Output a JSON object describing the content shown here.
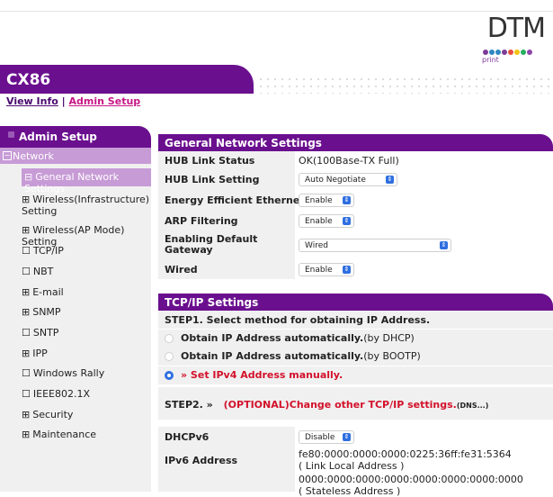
{
  "logo": {
    "text": "DTM",
    "sub": "print",
    "colors": [
      "#7d3c98",
      "#2e86c1",
      "#7d3c98",
      "#e74c3c",
      "#f1c40f",
      "#27ae60",
      "#7d3c98",
      "#8e44ad"
    ]
  },
  "header": {
    "title": "CX86",
    "view_info": "View Info",
    "separator": "|",
    "admin_setup": "Admin Setup"
  },
  "sidebar": {
    "head": "Admin Setup",
    "network": "Network",
    "items": [
      {
        "mark": "⊟",
        "label": "General Network Settings",
        "active": true
      },
      {
        "mark": "⊞",
        "label": "Wireless(Infrastructure) Setting"
      },
      {
        "mark": "⊞",
        "label": "Wireless(AP Mode) Setting"
      },
      {
        "mark": "☐",
        "label": "TCP/IP"
      },
      {
        "mark": "☐",
        "label": "NBT"
      },
      {
        "mark": "⊞",
        "label": "E-mail"
      },
      {
        "mark": "⊞",
        "label": "SNMP"
      },
      {
        "mark": "☐",
        "label": "SNTP"
      },
      {
        "mark": "⊞",
        "label": "IPP"
      },
      {
        "mark": "☐",
        "label": "Windows Rally"
      },
      {
        "mark": "☐",
        "label": "IEEE802.1X"
      },
      {
        "mark": "⊞",
        "label": "Security"
      },
      {
        "mark": "⊞",
        "label": "Maintenance"
      }
    ]
  },
  "general": {
    "title": "General Network Settings",
    "rows": [
      {
        "key": "HUB Link Status",
        "value": "OK(100Base-TX Full)"
      },
      {
        "key": "HUB Link Setting",
        "select": "Auto Negotiate"
      },
      {
        "key": "Energy Efficient Ethernet",
        "select": "Enable"
      },
      {
        "key": "ARP Filtering",
        "select": "Enable"
      },
      {
        "key": "Enabling Default Gateway",
        "select": "Wired"
      },
      {
        "key": "Wired",
        "select": "Enable"
      }
    ]
  },
  "tcpip": {
    "title": "TCP/IP Settings",
    "step1": "STEP1.  Select method for obtaining IP Address.",
    "opt1_bold": "Obtain IP Address automatically.",
    "opt1_tail": "(by DHCP)",
    "opt2_bold": "Obtain IP Address automatically.",
    "opt2_tail": "(by BOOTP)",
    "opt3": "»  Set IPv4 Address manually.",
    "step2_prefix": "STEP2.  »",
    "step2_red": "(OPTIONAL)Change other TCP/IP settings.",
    "step2_small": "(DNS...)",
    "dhcpv6_key": "DHCPv6",
    "dhcpv6_select": "Disable",
    "ipv6_key": "IPv6 Address",
    "ipv6_link": "fe80:0000:0000:0000:0225:36ff:fe31:5364",
    "ipv6_link_note": "( Link Local Address )",
    "ipv6_stateless": "0000:0000:0000:0000:0000:0000:0000:0000",
    "ipv6_stateless_note": "( Stateless Address )"
  }
}
